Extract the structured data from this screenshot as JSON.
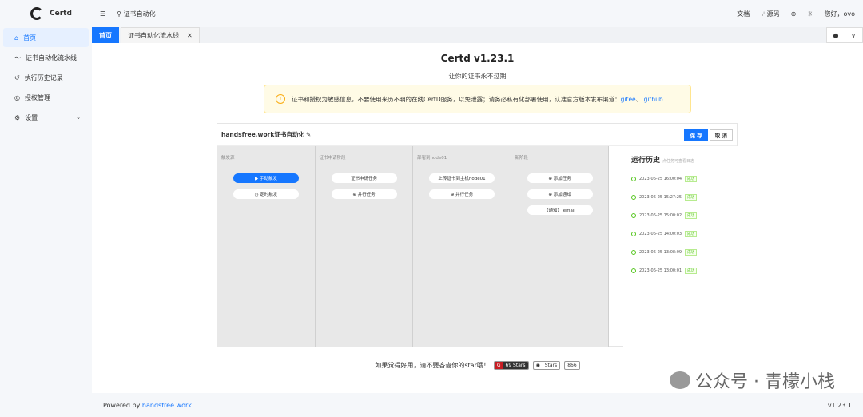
{
  "app": {
    "name": "Certd"
  },
  "sidebar": {
    "items": [
      {
        "label": "首页",
        "icon": "home-icon",
        "glyph": "⌂"
      },
      {
        "label": "证书自动化流水线",
        "icon": "pipeline-icon",
        "glyph": "〜"
      },
      {
        "label": "执行历史记录",
        "icon": "history-icon",
        "glyph": "↺"
      },
      {
        "label": "授权管理",
        "icon": "auth-icon",
        "glyph": "◎"
      },
      {
        "label": "设置",
        "icon": "gear-icon",
        "glyph": "⚙"
      }
    ]
  },
  "header": {
    "breadcrumb": "证书自动化",
    "docs": "文档",
    "source": "源码",
    "greeting": "您好，ovo"
  },
  "tabs": [
    {
      "label": "首页"
    },
    {
      "label": "证书自动化流水线"
    }
  ],
  "main": {
    "title": "Certd v1.23.1",
    "slogan": "让你的证书永不过期",
    "notice": {
      "text": "证书和授权为敏感信息，不要使用来历不明的在线CertD服务，以免泄露；请务必私有化部署使用，认准官方版本发布渠道：",
      "link1": "gitee",
      "sep": "、",
      "link2": "github"
    }
  },
  "pipeline": {
    "name": "handsfree.work证书自动化",
    "save": "保 存",
    "cancel": "取 消",
    "stages": [
      {
        "title": "触发源",
        "tasks": [
          "▶ 手动触发",
          "◷ 定时触发"
        ]
      },
      {
        "title": "证书申请阶段",
        "tasks": [
          "证书申请任务",
          "⊕ 并行任务"
        ]
      },
      {
        "title": "部署到node01",
        "tasks": [
          "上传证书到主机node01",
          "⊕ 并行任务"
        ]
      },
      {
        "title": "新阶段",
        "tasks": [
          "⊕ 添加任务",
          "⊕ 添加通知",
          "【通知】 email"
        ]
      }
    ],
    "history": {
      "title": "运行历史",
      "hint": "点任务可查看日志",
      "items": [
        {
          "time": "2023-06-25 16:00:04",
          "status": "成功"
        },
        {
          "time": "2023-06-25 15:27:25",
          "status": "成功"
        },
        {
          "time": "2023-06-25 15:00:02",
          "status": "成功"
        },
        {
          "time": "2023-06-25 14:00:03",
          "status": "成功"
        },
        {
          "time": "2023-06-25 13:08:09",
          "status": "成功"
        },
        {
          "time": "2023-06-25 13:00:01",
          "status": "成功"
        }
      ]
    }
  },
  "starline": {
    "text": "如果觉得好用，请不要吝啬你的star哦！",
    "gitee_stars": "69 Stars",
    "github_label": "Stars",
    "github_count": "866"
  },
  "watermark": "公众号 · 青檬小栈",
  "footer": {
    "powered": "Powered by ",
    "link": "handsfree.work",
    "version": "v1.23.1"
  }
}
